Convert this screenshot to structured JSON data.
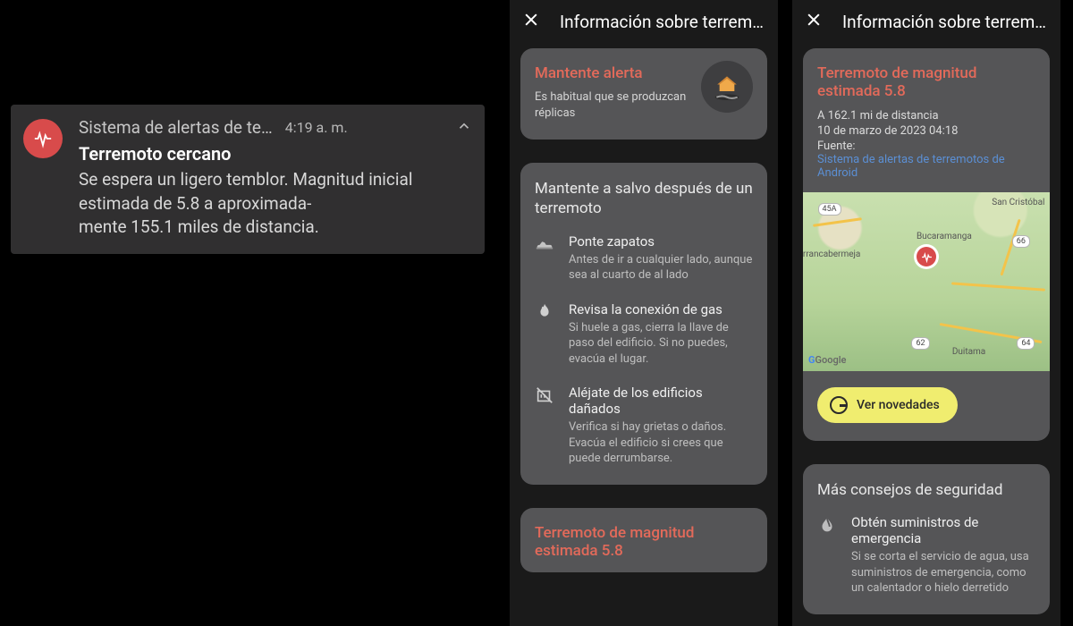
{
  "notification": {
    "app_name": "Sistema de alertas de te…",
    "time": "4:19 a. m.",
    "title": "Terremoto cercano",
    "body": "Se espera un ligero temblor. Magnitud inicial estimada de 5.8 a aproximada-\nmente 155.1 miles de distancia."
  },
  "screenA": {
    "appbar_title": "Información sobre terremot…",
    "stay_alert": {
      "title": "Mantente alerta",
      "subtitle": "Es habitual que se produzcan réplicas"
    },
    "safe_after": {
      "title": "Mantente a salvo después de un terremoto",
      "tips": [
        {
          "icon": "shoe",
          "label": "Ponte zapatos",
          "desc": "Antes de ir a cualquier lado, aunque sea al cuarto de al lado"
        },
        {
          "icon": "gas",
          "label": "Revisa la conexión de gas",
          "desc": "Si huele a gas, cierra la llave de paso del edificio. Si no puedes, evacúa el lugar."
        },
        {
          "icon": "building",
          "label": "Aléjate de los edificios dañados",
          "desc": "Verifica si hay grietas o daños. Evacúa el edificio si crees que puede derrumbarse."
        }
      ]
    },
    "quake_peek_title": "Terremoto de magnitud estimada 5.8"
  },
  "screenB": {
    "appbar_title": "Información sobre terremot…",
    "quake": {
      "title": "Terremoto de magnitud estimada 5.8",
      "distance": "A 162.1 mi de distancia",
      "date": "10 de marzo de 2023 04:18",
      "source_label": "Fuente:",
      "source_link": "Sistema de alertas de terremotos de Android",
      "map": {
        "badges": [
          "45A",
          "66",
          "64",
          "62"
        ],
        "cities": [
          "Bucaramanga",
          "arrancabermeja",
          "San Cristóbal",
          "Duitama"
        ],
        "attribution": "Google"
      },
      "chip": "Ver novedades"
    },
    "more": {
      "title": "Más consejos de seguridad",
      "tip": {
        "icon": "water",
        "label": "Obtén suministros de emergencia",
        "desc": "Si se corta el servicio de agua, usa suministros de emergencia, como un calentador o hielo derretido"
      }
    }
  }
}
